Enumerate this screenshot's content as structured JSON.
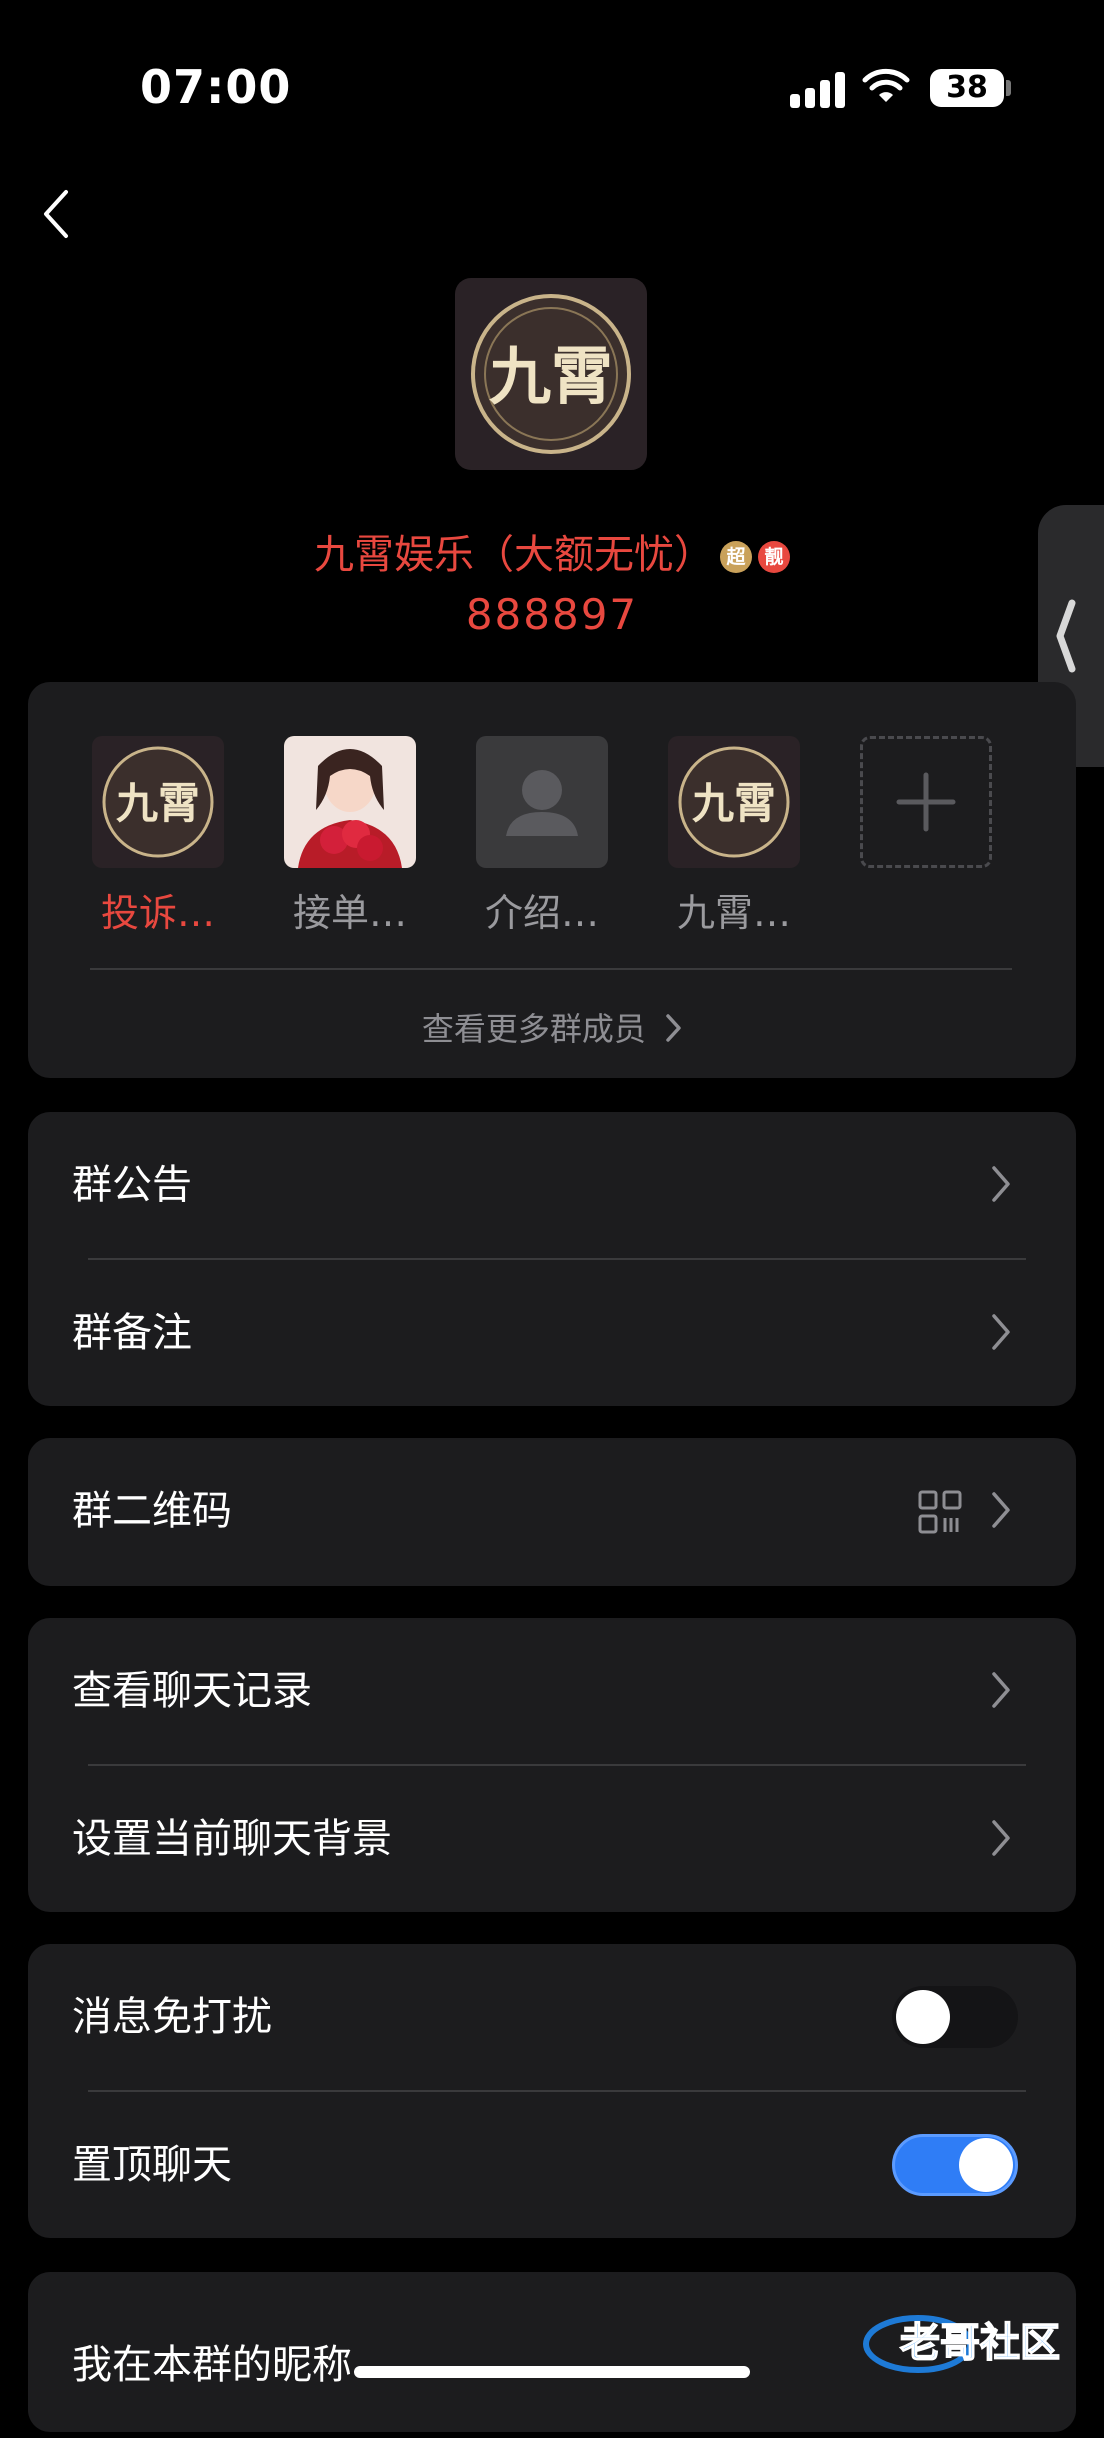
{
  "status_bar": {
    "time": "07:00",
    "battery": "38"
  },
  "group": {
    "name": "九霄娱乐（大额无忧）",
    "id": "888897",
    "badges": [
      {
        "text": "超",
        "color": "#c9a15a"
      },
      {
        "text": "靓",
        "color": "#e8483f"
      }
    ],
    "avatar_text": "九霄"
  },
  "members": [
    {
      "name": "投诉…",
      "highlight": true,
      "avatar": "group-logo"
    },
    {
      "name": "接单…",
      "highlight": false,
      "avatar": "photo"
    },
    {
      "name": "介绍…",
      "highlight": false,
      "avatar": "default-person"
    },
    {
      "name": "九霄…",
      "highlight": false,
      "avatar": "group-logo"
    }
  ],
  "members_more_label": "查看更多群成员",
  "settings": {
    "announcement": "群公告",
    "remark": "群备注",
    "qrcode": "群二维码",
    "chat_history": "查看聊天记录",
    "chat_background": "设置当前聊天背景",
    "do_not_disturb": {
      "label": "消息免打扰",
      "on": false
    },
    "pin_chat": {
      "label": "置顶聊天",
      "on": true
    },
    "my_nickname": "我在本群的昵称"
  },
  "watermark_text": "老哥社区",
  "colors": {
    "accent_red": "#e8483f",
    "toggle_on": "#2f7df6",
    "card_bg": "#1c1c1e"
  }
}
